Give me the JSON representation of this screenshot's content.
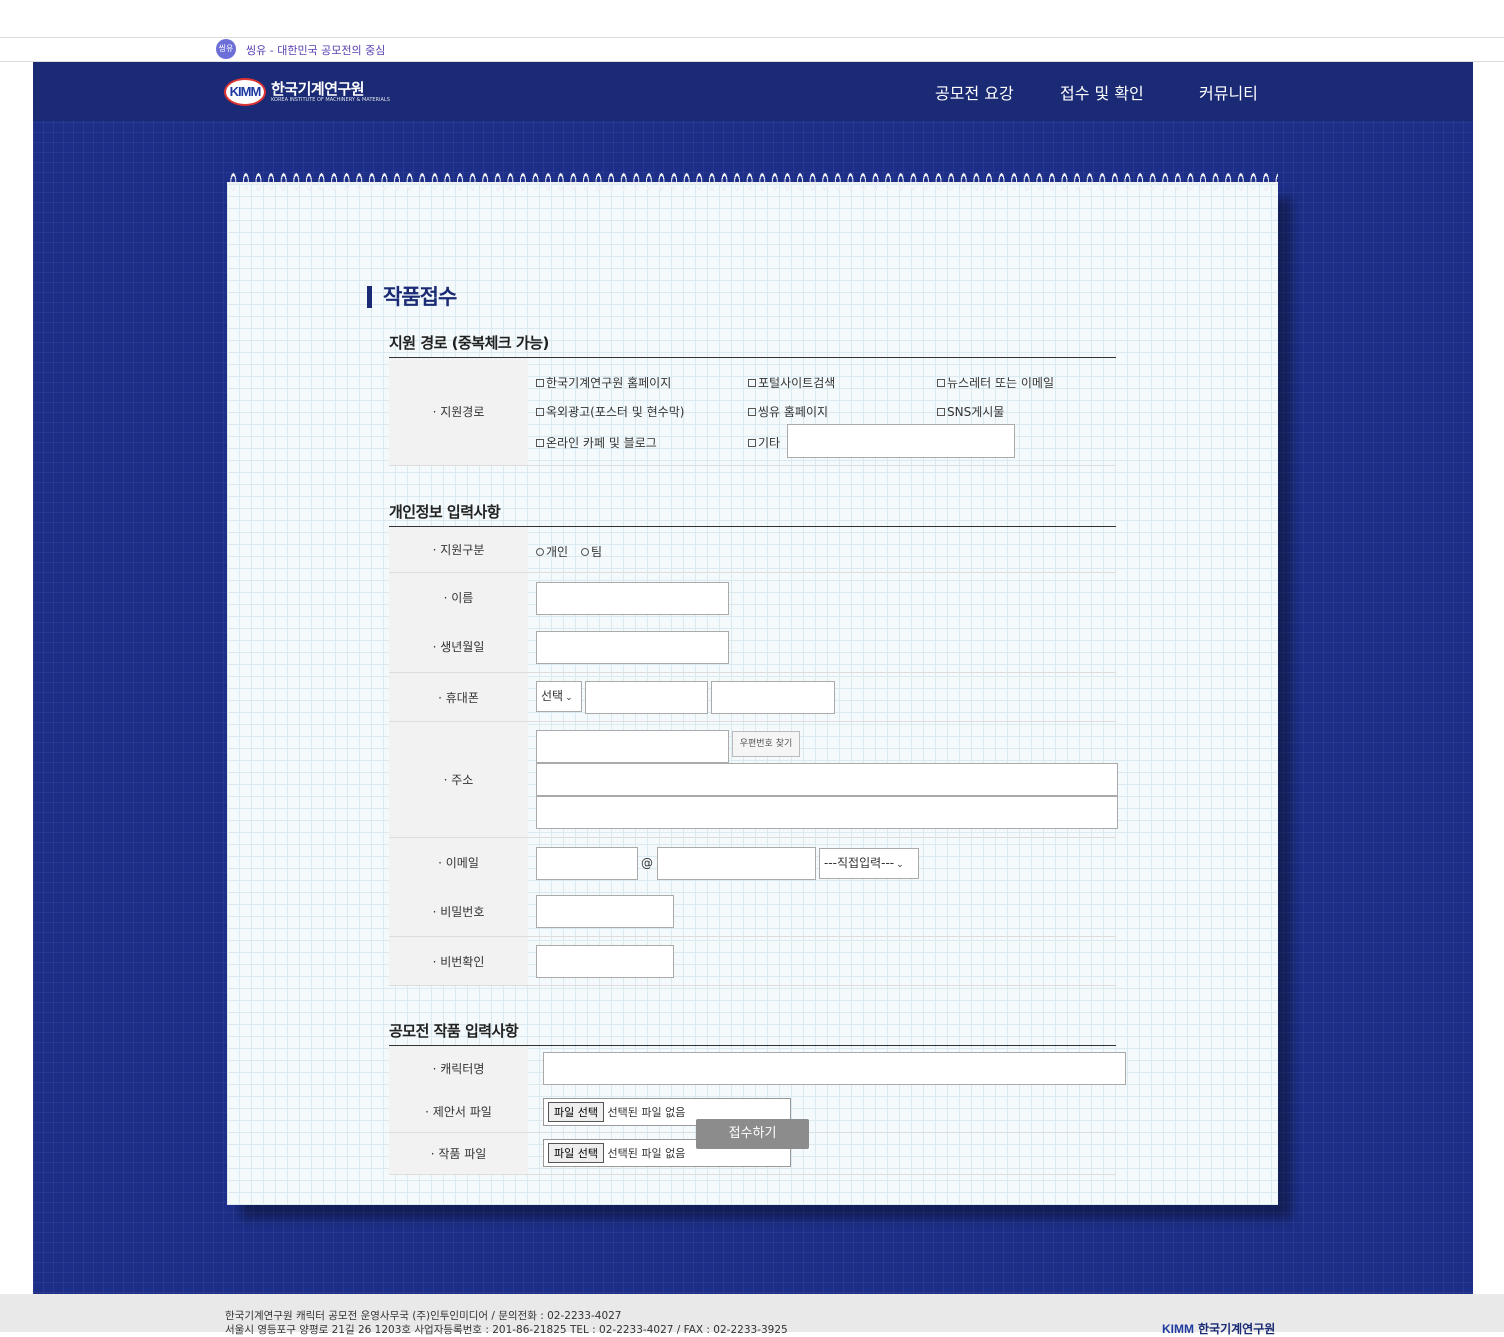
{
  "topbar": {
    "site_logo": "씽유",
    "site_name": "씽유 - 대한민국 공모전의 중심"
  },
  "header": {
    "logo_badge": "KIMM",
    "logo_ko": "한국기계연구원",
    "logo_en": "KOREA INSTITUTE OF MACHINERY & MATERIALS",
    "nav": [
      "공모전 요강",
      "접수 및 확인",
      "커뮤니티"
    ]
  },
  "form": {
    "title": "작품접수",
    "section1": {
      "title": "지원 경로 (중복체크 가능)",
      "label": "· 지원경로",
      "options": [
        "한국기계연구원 홈페이지",
        "포털사이트검색",
        "뉴스레터 또는 이메일",
        "옥외광고(포스터 및 현수막)",
        "씽유 홈페이지",
        "SNS게시물",
        "온라인 카페 및 블로그",
        "기타"
      ]
    },
    "section2": {
      "title": "개인정보 입력사항",
      "type_label": "· 지원구분",
      "type_options": [
        "개인",
        "팀"
      ],
      "name_label": "· 이름",
      "birth_label": "· 생년월일",
      "phone_label": "· 휴대폰",
      "phone_select": "선택",
      "address_label": "· 주소",
      "zip_button": "우편번호 찾기",
      "email_label": "· 이메일",
      "email_at": "@",
      "email_select": "---직접입력---",
      "password_label": "· 비밀번호",
      "password_confirm_label": "· 비번확인"
    },
    "section3": {
      "title": "공모전 작품 입력사항",
      "character_label": "· 캐릭터명",
      "proposal_label": "· 제안서 파일",
      "work_label": "· 작품 파일",
      "file_button": "파일 선택",
      "file_none": "선택된 파일 없음"
    },
    "submit": "접수하기"
  },
  "footer": {
    "line1": "한국기계연구원 캐릭터 공모전 운영사무국 (주)인투인미디어 / 문의전화 : 02-2233-4027",
    "line2": "서울시 영등포구 양평로 21길 26 1203호 사업자등록번호 : 201-86-21825 TEL : 02-2233-4027 / FAX : 02-2233-3925",
    "logo_badge": "KIMM",
    "logo_text": "한국기계연구원"
  }
}
